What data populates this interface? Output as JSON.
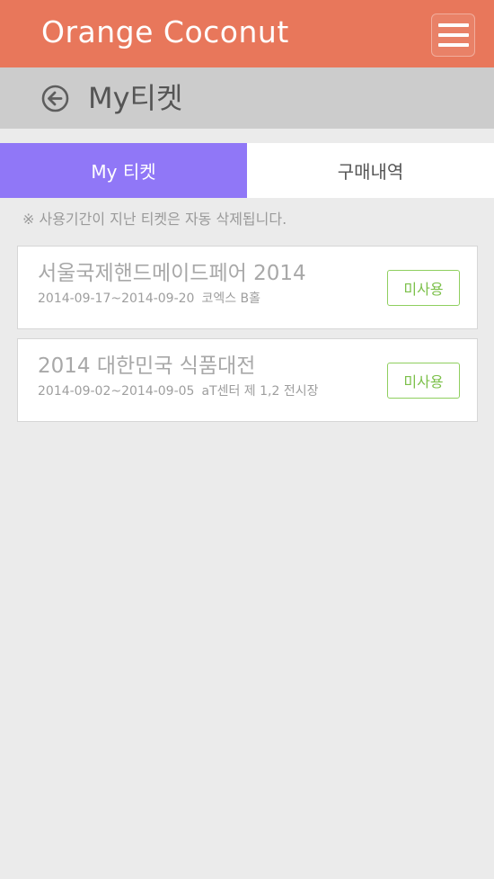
{
  "app": {
    "title": "Orange Coconut",
    "menu_icon": "hamburger-menu-icon",
    "bar_color": "#e8775b"
  },
  "header": {
    "title": "My티켓",
    "back_icon": "back-arrow-circle-icon"
  },
  "tabs": [
    {
      "label": "My 티켓",
      "active": true
    },
    {
      "label": "구매내역",
      "active": false
    }
  ],
  "notice": "※ 사용기간이 지난 티켓은 자동 삭제됩니다.",
  "tickets": [
    {
      "name": "서울국제핸드메이드페어 2014",
      "dates": "2014-09-17~2014-09-20",
      "venue": "코엑스 B홀",
      "status": "미사용"
    },
    {
      "name": "2014 대한민국 식품대전",
      "dates": "2014-09-02~2014-09-05",
      "venue": "aT센터 제 1,2 전시장",
      "status": "미사용"
    }
  ],
  "colors": {
    "accent_tab": "#9077f7",
    "status_green": "#7cc04a",
    "subheader_gray": "#cccccc"
  }
}
